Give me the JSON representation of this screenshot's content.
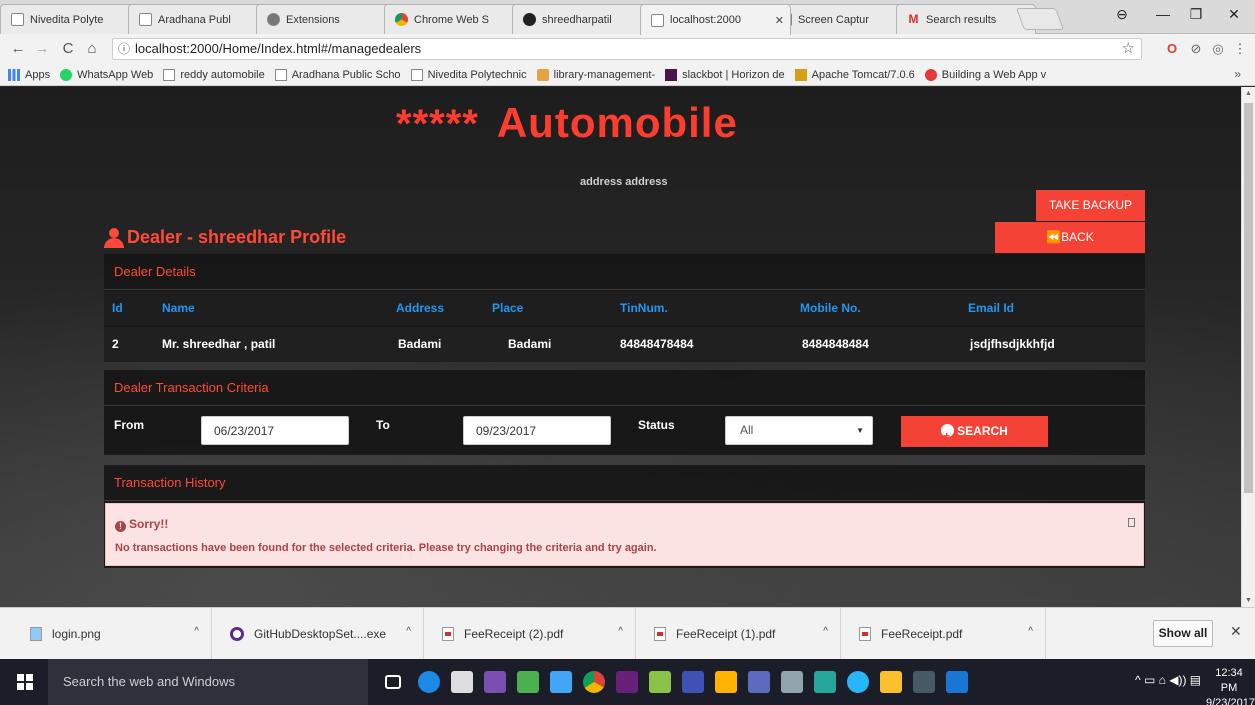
{
  "browser": {
    "tabs": [
      {
        "title": "Nivedita Polyte",
        "icon": "document-icon"
      },
      {
        "title": "Aradhana Publ",
        "icon": "document-icon"
      },
      {
        "title": "Extensions",
        "icon": "puzzle-icon"
      },
      {
        "title": "Chrome Web S",
        "icon": "chrome-web-store-icon"
      },
      {
        "title": "shreedharpatil",
        "icon": "github-icon"
      },
      {
        "title": "localhost:2000",
        "icon": "document-icon",
        "active": true
      },
      {
        "title": "Screen Captur",
        "icon": "camera-icon"
      },
      {
        "title": "Search results",
        "icon": "gmail-icon"
      }
    ],
    "url": "localhost:2000/Home/Index.html#/managedealers",
    "bookmarks": [
      "Apps",
      "WhatsApp Web",
      "reddy automobile",
      "Aradhana Public Scho",
      "Nivedita Polytechnic",
      "library-management-",
      "slackbot | Horizon de",
      "Apache Tomcat/7.0.6",
      "Building a Web App v"
    ]
  },
  "page": {
    "brand_stars": "*****",
    "brand_name": "Automobile",
    "address": "address address",
    "take_backup_label": "TAKE BACKUP",
    "back_label": "BACK",
    "profile_title": "Dealer - shreedhar Profile",
    "dealer_details": {
      "heading": "Dealer Details",
      "columns": [
        "Id",
        "Name",
        "Address",
        "Place",
        "TinNum.",
        "Mobile No.",
        "Email Id"
      ],
      "row": [
        "2",
        "Mr. shreedhar , patil",
        "Badami",
        "Badami",
        "84848478484",
        "8484848484",
        "jsdjfhsdjkkhfjd"
      ]
    },
    "criteria": {
      "heading": "Dealer Transaction Criteria",
      "from_label": "From",
      "from_value": "06/23/2017",
      "to_label": "To",
      "to_value": "09/23/2017",
      "status_label": "Status",
      "status_value": "All",
      "search_label": "SEARCH"
    },
    "history": {
      "heading": "Transaction History",
      "alert_title": "Sorry!!",
      "alert_message": "No transactions have been found for the selected criteria. Please try changing the criteria and try again."
    }
  },
  "downloads": {
    "items": [
      "login.png",
      "GitHubDesktopSet....exe",
      "FeeReceipt (2).pdf",
      "FeeReceipt (1).pdf",
      "FeeReceipt.pdf"
    ],
    "show_all": "Show all"
  },
  "taskbar": {
    "search_placeholder": "Search the web and Windows",
    "time": "12:34 PM",
    "date": "9/23/2017"
  },
  "colors": {
    "accent": "#f44336",
    "heading_red": "#ff4a3a",
    "table_header_blue": "#2196f3",
    "alert_bg": "#fbe3e3",
    "alert_text": "#a94442"
  }
}
